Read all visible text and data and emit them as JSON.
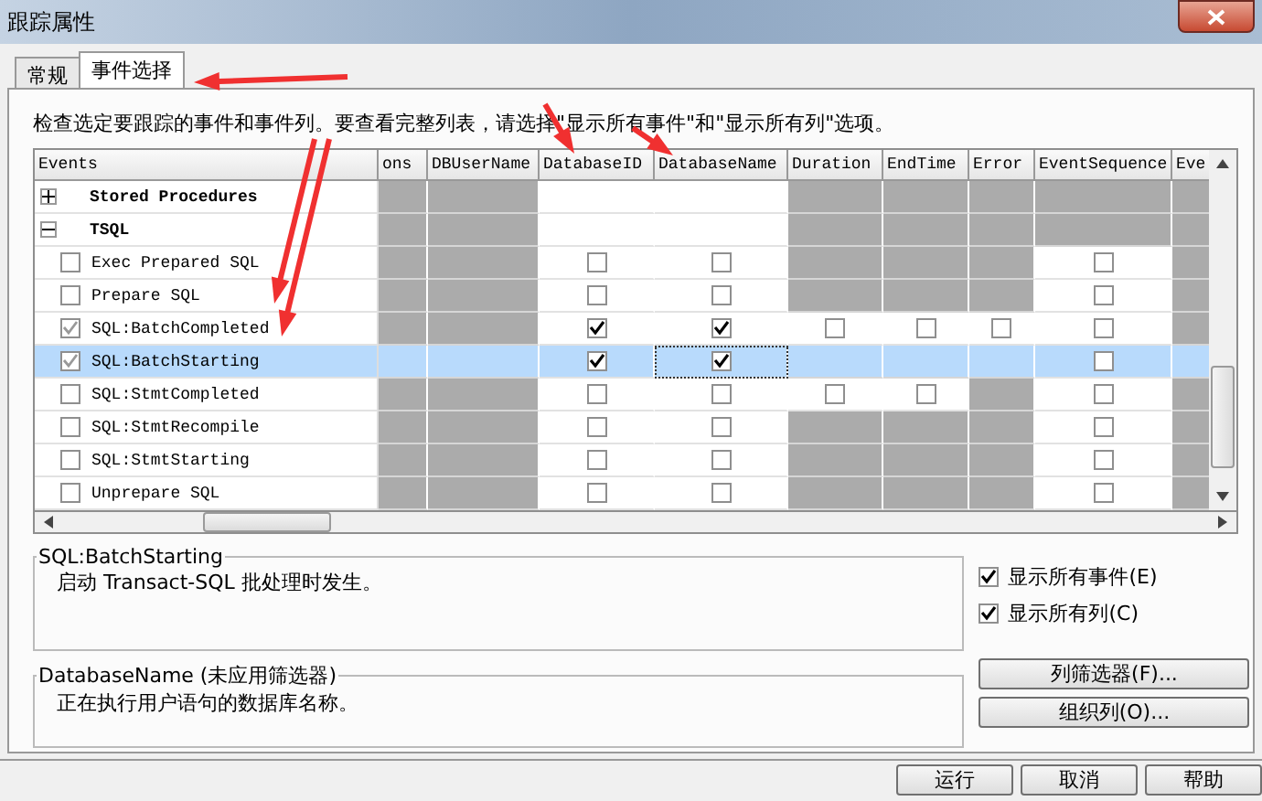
{
  "window": {
    "title": "跟踪属性"
  },
  "tabs": [
    {
      "label": "常规",
      "selected": false
    },
    {
      "label": "事件选择",
      "selected": true
    }
  ],
  "instruction": "检查选定要跟踪的事件和事件列。要查看完整列表，请选择\"显示所有事件\"和\"显示所有列\"选项。",
  "grid": {
    "columns": [
      "Events",
      "ons",
      "DBUserName",
      "DatabaseID",
      "DatabaseName",
      "Duration",
      "EndTime",
      "Error",
      "EventSequence",
      "Eve"
    ],
    "rows": [
      {
        "kind": "category",
        "label": "Stored Procedures",
        "expanded": false,
        "selected": false,
        "cells": [
          {
            "kind": "na"
          },
          {
            "kind": "na"
          },
          {
            "kind": "blank"
          },
          {
            "kind": "blank"
          },
          {
            "kind": "na"
          },
          {
            "kind": "na"
          },
          {
            "kind": "na"
          },
          {
            "kind": "na"
          },
          {
            "kind": "na"
          }
        ]
      },
      {
        "kind": "category",
        "label": "TSQL",
        "expanded": true,
        "selected": false,
        "cells": [
          {
            "kind": "na"
          },
          {
            "kind": "na"
          },
          {
            "kind": "blank"
          },
          {
            "kind": "blank"
          },
          {
            "kind": "na"
          },
          {
            "kind": "na"
          },
          {
            "kind": "na"
          },
          {
            "kind": "na"
          },
          {
            "kind": "na"
          }
        ]
      },
      {
        "kind": "event",
        "label": "Exec Prepared SQL",
        "checked": false,
        "selected": false,
        "cells": [
          {
            "kind": "na"
          },
          {
            "kind": "na"
          },
          {
            "kind": "box",
            "checked": false
          },
          {
            "kind": "box",
            "checked": false
          },
          {
            "kind": "na"
          },
          {
            "kind": "na"
          },
          {
            "kind": "na"
          },
          {
            "kind": "box",
            "checked": false
          },
          {
            "kind": "na"
          }
        ]
      },
      {
        "kind": "event",
        "label": "Prepare SQL",
        "checked": false,
        "selected": false,
        "cells": [
          {
            "kind": "na"
          },
          {
            "kind": "na"
          },
          {
            "kind": "box",
            "checked": false
          },
          {
            "kind": "box",
            "checked": false
          },
          {
            "kind": "na"
          },
          {
            "kind": "na"
          },
          {
            "kind": "na"
          },
          {
            "kind": "box",
            "checked": false
          },
          {
            "kind": "na"
          }
        ]
      },
      {
        "kind": "event",
        "label": "SQL:BatchCompleted",
        "checked": true,
        "selected": false,
        "cells": [
          {
            "kind": "na"
          },
          {
            "kind": "na"
          },
          {
            "kind": "box",
            "checked": true
          },
          {
            "kind": "box",
            "checked": true
          },
          {
            "kind": "box",
            "checked": false
          },
          {
            "kind": "box",
            "checked": false
          },
          {
            "kind": "box",
            "checked": false
          },
          {
            "kind": "box",
            "checked": false
          },
          {
            "kind": "na"
          }
        ]
      },
      {
        "kind": "event",
        "label": "SQL:BatchStarting",
        "checked": true,
        "selected": true,
        "cells": [
          {
            "kind": "na"
          },
          {
            "kind": "na"
          },
          {
            "kind": "box",
            "checked": true
          },
          {
            "kind": "box",
            "checked": true
          },
          {
            "kind": "na"
          },
          {
            "kind": "na"
          },
          {
            "kind": "na"
          },
          {
            "kind": "box",
            "checked": false
          },
          {
            "kind": "na"
          }
        ]
      },
      {
        "kind": "event",
        "label": "SQL:StmtCompleted",
        "checked": false,
        "selected": false,
        "cells": [
          {
            "kind": "na"
          },
          {
            "kind": "na"
          },
          {
            "kind": "box",
            "checked": false
          },
          {
            "kind": "box",
            "checked": false
          },
          {
            "kind": "box",
            "checked": false
          },
          {
            "kind": "box",
            "checked": false
          },
          {
            "kind": "na"
          },
          {
            "kind": "box",
            "checked": false
          },
          {
            "kind": "na"
          }
        ]
      },
      {
        "kind": "event",
        "label": "SQL:StmtRecompile",
        "checked": false,
        "selected": false,
        "cells": [
          {
            "kind": "na"
          },
          {
            "kind": "na"
          },
          {
            "kind": "box",
            "checked": false
          },
          {
            "kind": "box",
            "checked": false
          },
          {
            "kind": "na"
          },
          {
            "kind": "na"
          },
          {
            "kind": "na"
          },
          {
            "kind": "box",
            "checked": false
          },
          {
            "kind": "na"
          }
        ]
      },
      {
        "kind": "event",
        "label": "SQL:StmtStarting",
        "checked": false,
        "selected": false,
        "cells": [
          {
            "kind": "na"
          },
          {
            "kind": "na"
          },
          {
            "kind": "box",
            "checked": false
          },
          {
            "kind": "box",
            "checked": false
          },
          {
            "kind": "na"
          },
          {
            "kind": "na"
          },
          {
            "kind": "na"
          },
          {
            "kind": "box",
            "checked": false
          },
          {
            "kind": "na"
          }
        ]
      },
      {
        "kind": "event",
        "label": "Unprepare SQL",
        "checked": false,
        "selected": false,
        "cells": [
          {
            "kind": "na"
          },
          {
            "kind": "na"
          },
          {
            "kind": "box",
            "checked": false
          },
          {
            "kind": "box",
            "checked": false
          },
          {
            "kind": "na"
          },
          {
            "kind": "na"
          },
          {
            "kind": "na"
          },
          {
            "kind": "box",
            "checked": false
          },
          {
            "kind": "na"
          }
        ]
      }
    ]
  },
  "event_info": {
    "title": "SQL:BatchStarting",
    "description": "启动 Transact-SQL 批处理时发生。"
  },
  "column_info": {
    "title": "DatabaseName (未应用筛选器)",
    "description": "正在执行用户语句的数据库名称。"
  },
  "options": [
    {
      "label": "显示所有事件(E)",
      "checked": true
    },
    {
      "label": "显示所有列(C)",
      "checked": true
    }
  ],
  "side_buttons": [
    "列筛选器(F)...",
    "组织列(O)..."
  ],
  "footer_buttons": [
    "运行",
    "取消",
    "帮助"
  ]
}
